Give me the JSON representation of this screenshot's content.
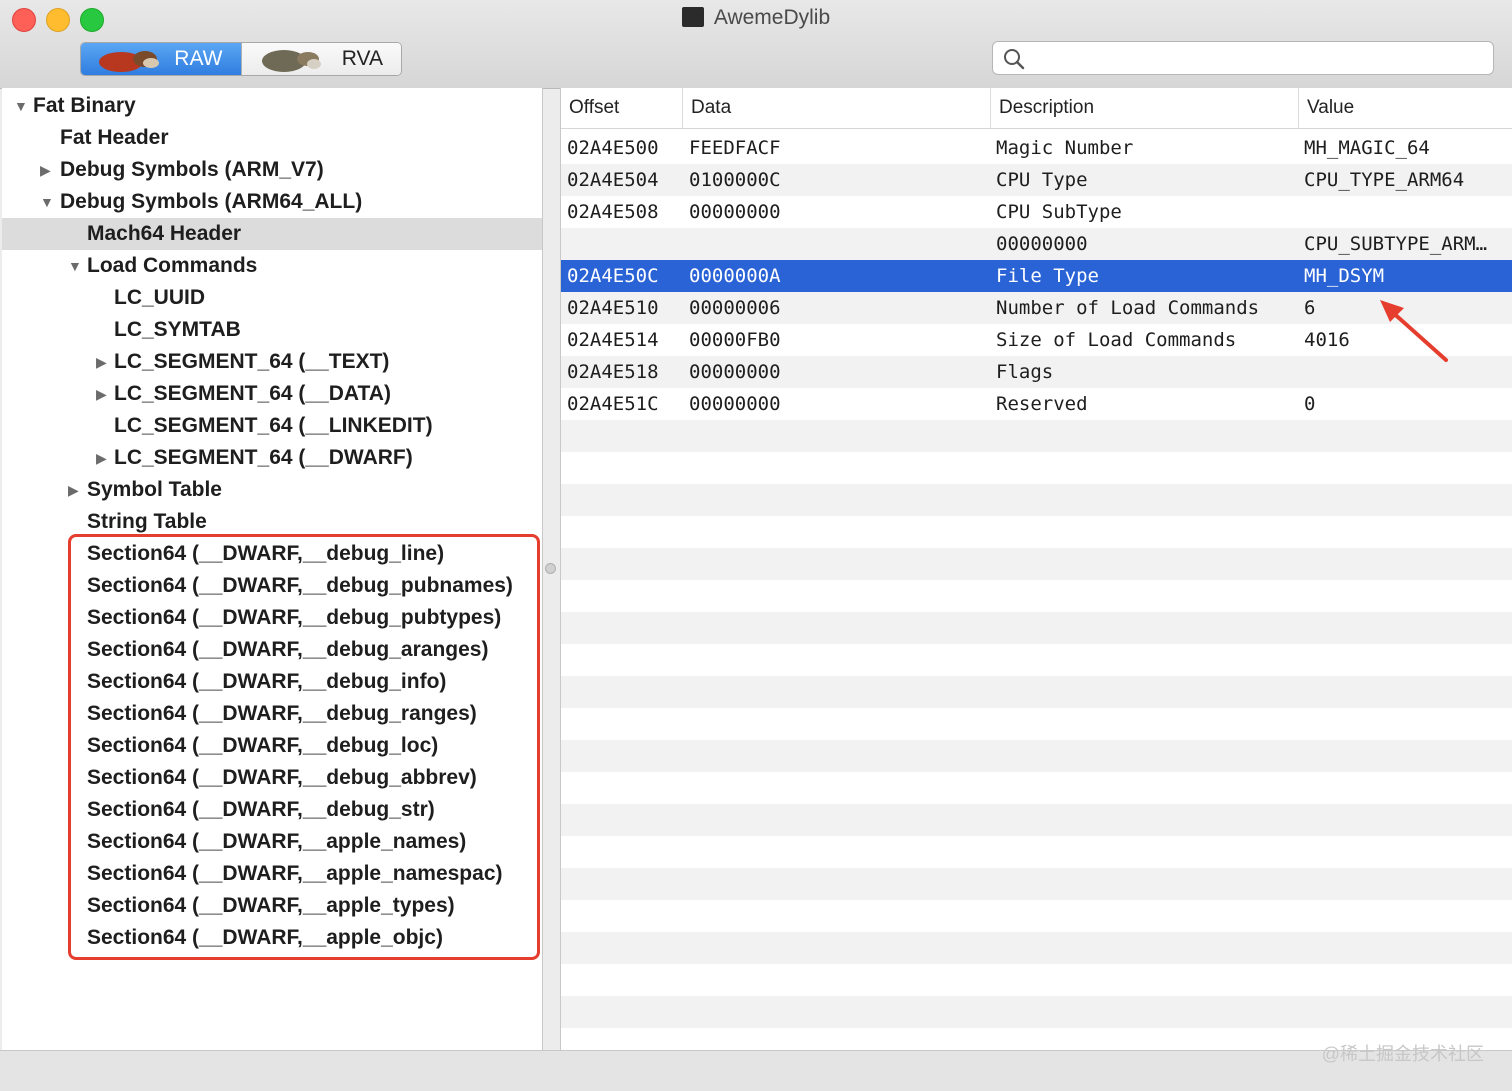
{
  "window": {
    "title": "AwemeDylib"
  },
  "toolbar": {
    "segments": [
      {
        "label": "RAW",
        "selected": true
      },
      {
        "label": "RVA",
        "selected": false
      }
    ],
    "search": {
      "value": "",
      "placeholder": ""
    }
  },
  "tree": [
    {
      "label": "Fat Binary",
      "indent": 0,
      "expander": "expanded"
    },
    {
      "label": "Fat Header",
      "indent": 1,
      "expander": "none"
    },
    {
      "label": "Debug Symbols (ARM_V7)",
      "indent": 1,
      "expander": "collapsed"
    },
    {
      "label": "Debug Symbols (ARM64_ALL)",
      "indent": 1,
      "expander": "expanded"
    },
    {
      "label": "Mach64 Header",
      "indent": 2,
      "expander": "none",
      "selected": true
    },
    {
      "label": "Load Commands",
      "indent": 2,
      "expander": "expanded"
    },
    {
      "label": "LC_UUID",
      "indent": 3,
      "expander": "none"
    },
    {
      "label": "LC_SYMTAB",
      "indent": 3,
      "expander": "none"
    },
    {
      "label": "LC_SEGMENT_64 (__TEXT)",
      "indent": 3,
      "expander": "collapsed"
    },
    {
      "label": "LC_SEGMENT_64 (__DATA)",
      "indent": 3,
      "expander": "collapsed"
    },
    {
      "label": "LC_SEGMENT_64 (__LINKEDIT)",
      "indent": 3,
      "expander": "none"
    },
    {
      "label": "LC_SEGMENT_64 (__DWARF)",
      "indent": 3,
      "expander": "collapsed"
    },
    {
      "label": "Symbol Table",
      "indent": 2,
      "expander": "collapsed"
    },
    {
      "label": "String Table",
      "indent": 2,
      "expander": "none"
    },
    {
      "label": "Section64 (__DWARF,__debug_line)",
      "indent": 2,
      "expander": "none"
    },
    {
      "label": "Section64 (__DWARF,__debug_pubnames)",
      "indent": 2,
      "expander": "none"
    },
    {
      "label": "Section64 (__DWARF,__debug_pubtypes)",
      "indent": 2,
      "expander": "none"
    },
    {
      "label": "Section64 (__DWARF,__debug_aranges)",
      "indent": 2,
      "expander": "none"
    },
    {
      "label": "Section64 (__DWARF,__debug_info)",
      "indent": 2,
      "expander": "none"
    },
    {
      "label": "Section64 (__DWARF,__debug_ranges)",
      "indent": 2,
      "expander": "none"
    },
    {
      "label": "Section64 (__DWARF,__debug_loc)",
      "indent": 2,
      "expander": "none"
    },
    {
      "label": "Section64 (__DWARF,__debug_abbrev)",
      "indent": 2,
      "expander": "none"
    },
    {
      "label": "Section64 (__DWARF,__debug_str)",
      "indent": 2,
      "expander": "none"
    },
    {
      "label": "Section64 (__DWARF,__apple_names)",
      "indent": 2,
      "expander": "none"
    },
    {
      "label": "Section64 (__DWARF,__apple_namespac)",
      "indent": 2,
      "expander": "none"
    },
    {
      "label": "Section64 (__DWARF,__apple_types)",
      "indent": 2,
      "expander": "none"
    },
    {
      "label": "Section64 (__DWARF,__apple_objc)",
      "indent": 2,
      "expander": "none"
    }
  ],
  "table": {
    "columns": [
      "Offset",
      "Data",
      "Description",
      "Value"
    ],
    "rows": [
      {
        "offset": "02A4E500",
        "data": "FEEDFACF",
        "description": "Magic Number",
        "value": "MH_MAGIC_64"
      },
      {
        "offset": "02A4E504",
        "data": "0100000C",
        "description": "CPU Type",
        "value": "CPU_TYPE_ARM64"
      },
      {
        "offset": "02A4E508",
        "data": "00000000",
        "description": "CPU SubType",
        "value": ""
      },
      {
        "offset": "",
        "data": "",
        "description": "00000000",
        "value": "CPU_SUBTYPE_ARM…"
      },
      {
        "offset": "02A4E50C",
        "data": "0000000A",
        "description": "File Type",
        "value": "MH_DSYM",
        "selected": true
      },
      {
        "offset": "02A4E510",
        "data": "00000006",
        "description": "Number of Load Commands",
        "value": "6"
      },
      {
        "offset": "02A4E514",
        "data": "00000FB0",
        "description": "Size of Load Commands",
        "value": "4016"
      },
      {
        "offset": "02A4E518",
        "data": "00000000",
        "description": "Flags",
        "value": ""
      },
      {
        "offset": "02A4E51C",
        "data": "00000000",
        "description": "Reserved",
        "value": "0"
      }
    ]
  },
  "watermark": "@稀土掘金技术社区",
  "colors": {
    "selection": "#2a63d6",
    "annotation": "#e53e2e",
    "segment_active": "#3b86e8"
  }
}
